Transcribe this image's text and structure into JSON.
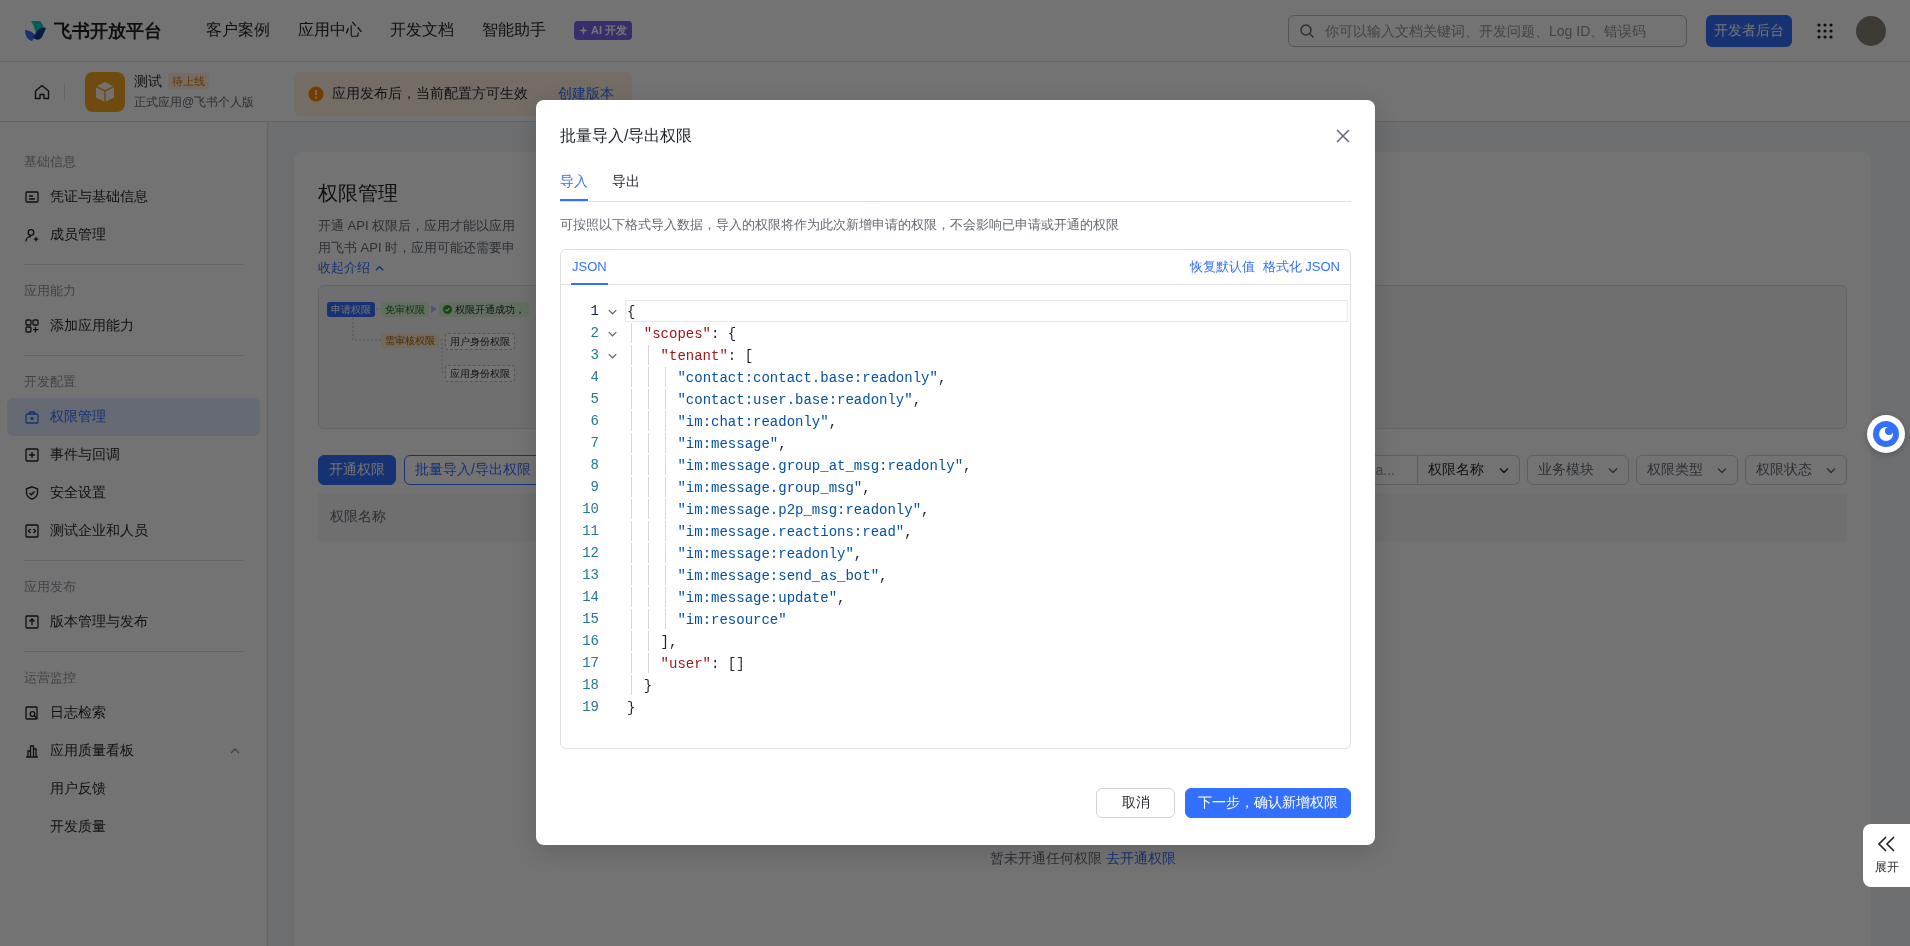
{
  "header": {
    "brand": "飞书开放平台",
    "nav": [
      {
        "label": "客户案例"
      },
      {
        "label": "应用中心"
      },
      {
        "label": "开发文档"
      },
      {
        "label": "智能助手",
        "badge": "AI 开发"
      }
    ],
    "search": {
      "placeholder": "你可以输入文档关键词、开发问题、Log ID、错误码"
    },
    "console_button": "开发者后台"
  },
  "app_bar": {
    "app_name": "测试",
    "status_tag": "待上线",
    "app_subtitle": "正式应用@飞书个人版",
    "notice": {
      "text": "应用发布后，当前配置方可生效",
      "link": "创建版本"
    }
  },
  "sidebar": {
    "groups": [
      {
        "title": "基础信息",
        "items": [
          {
            "label": "凭证与基础信息",
            "selected": false
          },
          {
            "label": "成员管理",
            "selected": false
          }
        ]
      },
      {
        "title": "应用能力",
        "items": [
          {
            "label": "添加应用能力",
            "selected": false
          }
        ]
      },
      {
        "title": "开发配置",
        "items": [
          {
            "label": "权限管理",
            "selected": true
          },
          {
            "label": "事件与回调",
            "selected": false
          },
          {
            "label": "安全设置",
            "selected": false
          },
          {
            "label": "测试企业和人员",
            "selected": false
          }
        ]
      },
      {
        "title": "应用发布",
        "items": [
          {
            "label": "版本管理与发布",
            "selected": false
          }
        ]
      },
      {
        "title": "运营监控",
        "items": [
          {
            "label": "日志检索",
            "selected": false
          },
          {
            "label": "应用质量看板",
            "selected": false,
            "expanded": true,
            "children": [
              {
                "label": "用户反馈",
                "selected": false
              },
              {
                "label": "开发质量",
                "selected": false
              }
            ]
          }
        ]
      }
    ]
  },
  "page": {
    "title": "权限管理",
    "intro_lines": [
      "开通 API 权限后，应用才能以应用",
      "用飞书 API 时，应用可能还需要申"
    ],
    "collapse_link": "收起介绍",
    "flow_diagram": {
      "request": "申请权限",
      "auto": "免审权限",
      "success": "权限开通成功，",
      "review": "需审核权限",
      "user_scope": "用户身份权限",
      "tenant_scope": "应用身份权限"
    },
    "buttons": [
      {
        "label": "开通权限",
        "kind": "primary"
      },
      {
        "label": "批量导入/导出权限",
        "kind": "outline"
      }
    ],
    "filters": {
      "search_text": "a...",
      "dropdowns": [
        "权限名称",
        "业务模块",
        "权限类型",
        "权限状态"
      ]
    },
    "table": {
      "columns": [
        "权限名称"
      ]
    },
    "empty_text": "暂未开通任何权限",
    "empty_link": "去开通权限"
  },
  "dialog": {
    "title": "批量导入/导出权限",
    "tabs": [
      {
        "label": "导入",
        "selected": true
      },
      {
        "label": "导出",
        "selected": false
      }
    ],
    "description": "可按照以下格式导入数据，导入的权限将作为此次新增申请的权限，不会影响已申请或开通的权限",
    "editor": {
      "tabs": [
        {
          "label": "JSON",
          "selected": true
        }
      ],
      "actions": [
        "恢复默认值",
        "格式化 JSON"
      ],
      "lines": [
        {
          "number": "1",
          "text": "{",
          "expanded": true,
          "active": true
        },
        {
          "number": "2",
          "text": "  \"scopes\": {",
          "expanded": true,
          "active": false
        },
        {
          "number": "3",
          "text": "    \"tenant\": [",
          "expanded": true,
          "active": false
        },
        {
          "number": "4",
          "text": "      \"contact:contact.base:readonly\",",
          "active": false
        },
        {
          "number": "5",
          "text": "      \"contact:user.base:readonly\",",
          "active": false
        },
        {
          "number": "6",
          "text": "      \"im:chat:readonly\",",
          "active": false
        },
        {
          "number": "7",
          "text": "      \"im:message\",",
          "active": false
        },
        {
          "number": "8",
          "text": "      \"im:message.group_at_msg:readonly\",",
          "active": false
        },
        {
          "number": "9",
          "text": "      \"im:message.group_msg\",",
          "active": false
        },
        {
          "number": "10",
          "text": "      \"im:message.p2p_msg:readonly\",",
          "active": false
        },
        {
          "number": "11",
          "text": "      \"im:message.reactions:read\",",
          "active": false
        },
        {
          "number": "12",
          "text": "      \"im:message:readonly\",",
          "active": false
        },
        {
          "number": "13",
          "text": "      \"im:message:send_as_bot\",",
          "active": false
        },
        {
          "number": "14",
          "text": "      \"im:message:update\",",
          "active": false
        },
        {
          "number": "15",
          "text": "      \"im:resource\"",
          "active": false
        },
        {
          "number": "16",
          "text": "    ],",
          "active": false
        },
        {
          "number": "17",
          "text": "    \"user\": []",
          "active": false
        },
        {
          "number": "18",
          "text": "  }",
          "active": false
        },
        {
          "number": "19",
          "text": "}",
          "active": false
        }
      ]
    },
    "buttons": [
      {
        "label": "取消",
        "kind": "secondary"
      },
      {
        "label": "下一步，确认新增权限",
        "kind": "primary"
      }
    ]
  },
  "float_tools": {
    "expand_label": "展开"
  }
}
